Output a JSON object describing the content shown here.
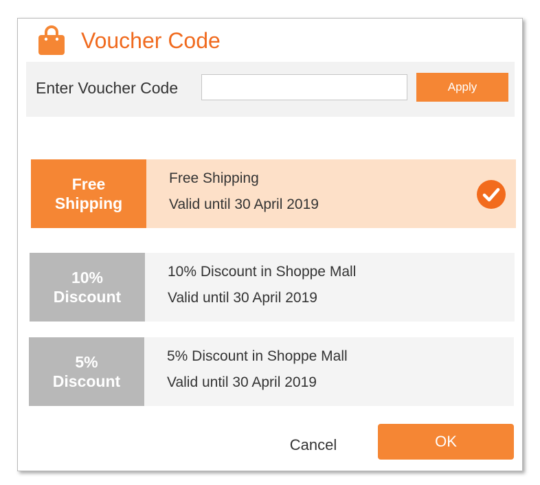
{
  "dialog": {
    "title": "Voucher Code",
    "icon": "shopping-bag-icon",
    "accent_color": "#f58634",
    "title_color": "#f06a1e"
  },
  "code_entry": {
    "label": "Enter Voucher Code",
    "value": "",
    "placeholder": "",
    "apply_label": "Apply"
  },
  "vouchers": [
    {
      "tag_line1": "Free",
      "tag_line2": "Shipping",
      "name": "Free Shipping",
      "valid": "Valid until 30 April 2019",
      "selected": true,
      "tag_color": "#f58634",
      "body_color": "#fde0c8"
    },
    {
      "tag_line1": "10%",
      "tag_line2": "Discount",
      "name": "10% Discount in Shoppe Mall",
      "valid": "Valid until 30 April 2019",
      "selected": false,
      "tag_color": "#b8b8b8",
      "body_color": "#f4f4f4"
    },
    {
      "tag_line1": "5%",
      "tag_line2": "Discount",
      "name": "5% Discount in Shoppe Mall",
      "valid": "Valid until 30 April 2019",
      "selected": false,
      "tag_color": "#b8b8b8",
      "body_color": "#f4f4f4"
    }
  ],
  "footer": {
    "cancel_label": "Cancel",
    "ok_label": "OK"
  }
}
